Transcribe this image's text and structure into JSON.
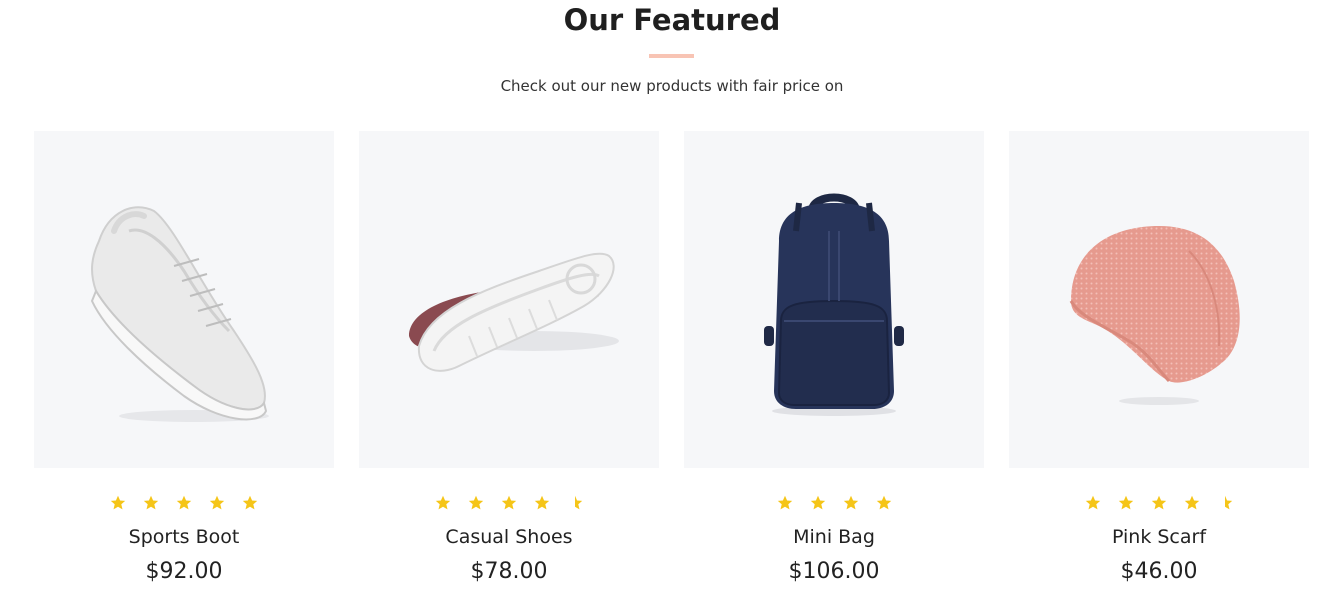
{
  "section": {
    "title": "Our Featured",
    "subtitle": "Check out our new products with fair price on"
  },
  "colors": {
    "accent_underline": "#f8c4b4",
    "star": "#f5c518",
    "image_background": "#f6f7f9"
  },
  "products": [
    {
      "name": "Sports Boot",
      "price": "$92.00",
      "rating": 5,
      "image_icon": "white-sneaker-image"
    },
    {
      "name": "Casual Shoes",
      "price": "$78.00",
      "rating": 4.5,
      "image_icon": "maroon-shoe-sole-image"
    },
    {
      "name": "Mini Bag",
      "price": "$106.00",
      "rating": 4,
      "image_icon": "navy-backpack-image"
    },
    {
      "name": "Pink Scarf",
      "price": "$46.00",
      "rating": 4.5,
      "image_icon": "pink-beanie-image"
    }
  ]
}
